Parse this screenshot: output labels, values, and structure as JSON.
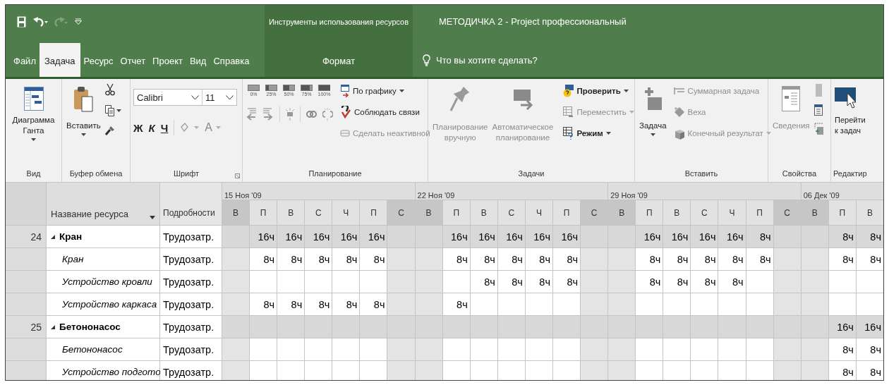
{
  "window": {
    "context_title": "Инструменты использования ресурсов",
    "title": "МЕТОДИЧКА 2  -  Project профессиональный"
  },
  "tabs": [
    {
      "label": "Файл",
      "selected": false,
      "kind": "main"
    },
    {
      "label": "Задача",
      "selected": true,
      "kind": "main"
    },
    {
      "label": "Ресурс",
      "selected": false,
      "kind": "main"
    },
    {
      "label": "Отчет",
      "selected": false,
      "kind": "main"
    },
    {
      "label": "Проект",
      "selected": false,
      "kind": "main"
    },
    {
      "label": "Вид",
      "selected": false,
      "kind": "main"
    },
    {
      "label": "Справка",
      "selected": false,
      "kind": "main"
    },
    {
      "label": "Формат",
      "selected": false,
      "kind": "contextual"
    }
  ],
  "tell_me": {
    "placeholder": "Что вы хотите сделать?"
  },
  "ribbon": {
    "groups": [
      {
        "kind": "view",
        "label": "Вид",
        "button": {
          "lines": [
            "Диаграмма",
            "Ганта"
          ],
          "dropdown": true
        }
      },
      {
        "kind": "clipboard",
        "label": "Буфер обмена",
        "paste": {
          "label": "Вставить",
          "dropdown": true
        }
      },
      {
        "kind": "font",
        "label": "Шрифт",
        "font_name": "Calibri",
        "font_size": "11",
        "bold": "Ж",
        "italic": "К",
        "underline": "Ч",
        "font_color": "A"
      },
      {
        "kind": "schedule",
        "label": "Планирование",
        "percent": [
          "0%",
          "25%",
          "50%",
          "75%",
          "100%"
        ],
        "commands": [
          {
            "label": "По графику",
            "dropdown": true,
            "disabled": false
          },
          {
            "label": "Соблюдать связи",
            "dropdown": false,
            "disabled": false
          },
          {
            "label": "Сделать неактивной",
            "dropdown": false,
            "disabled": true
          }
        ]
      },
      {
        "kind": "tasks",
        "label": "Задачи",
        "large": [
          {
            "lines": [
              "Планирование",
              "вручную"
            ],
            "disabled": true
          },
          {
            "lines": [
              "Автоматическое",
              "планирование"
            ],
            "disabled": true
          }
        ],
        "commands": [
          {
            "label": "Проверить",
            "dropdown": true,
            "disabled": false
          },
          {
            "label": "Переместить",
            "dropdown": true,
            "disabled": true
          },
          {
            "label": "Режим",
            "dropdown": true,
            "disabled": false
          }
        ]
      },
      {
        "kind": "insert",
        "label": "Вставить",
        "large": {
          "label": "Задача",
          "dropdown": true
        },
        "commands": [
          {
            "label": "Суммарная задача",
            "dropdown": false,
            "disabled": true
          },
          {
            "label": "Веха",
            "dropdown": false,
            "disabled": true
          },
          {
            "label": "Конечный результат",
            "dropdown": true,
            "disabled": true
          }
        ]
      },
      {
        "kind": "properties",
        "label": "Свойства",
        "large": {
          "label": "Сведения",
          "disabled": true
        }
      },
      {
        "kind": "editing",
        "label": "Редактир",
        "large": {
          "lines": [
            "Перейти",
            "к задач"
          ]
        }
      }
    ]
  },
  "table": {
    "name_header": "Название ресурса",
    "details_header": "Подробности",
    "weeks": [
      {
        "label": "15 Ноя '09",
        "days": [
          {
            "label": "В",
            "weekend": true
          },
          {
            "label": "П",
            "weekend": false
          },
          {
            "label": "В",
            "weekend": false
          },
          {
            "label": "С",
            "weekend": false
          },
          {
            "label": "Ч",
            "weekend": false
          },
          {
            "label": "П",
            "weekend": false
          },
          {
            "label": "С",
            "weekend": true
          }
        ]
      },
      {
        "label": "22 Ноя '09",
        "days": [
          {
            "label": "В",
            "weekend": true
          },
          {
            "label": "П",
            "weekend": false
          },
          {
            "label": "В",
            "weekend": false
          },
          {
            "label": "С",
            "weekend": false
          },
          {
            "label": "Ч",
            "weekend": false
          },
          {
            "label": "П",
            "weekend": false
          },
          {
            "label": "С",
            "weekend": true
          }
        ]
      },
      {
        "label": "29 Ноя '09",
        "days": [
          {
            "label": "В",
            "weekend": true
          },
          {
            "label": "П",
            "weekend": false
          },
          {
            "label": "В",
            "weekend": false
          },
          {
            "label": "С",
            "weekend": false
          },
          {
            "label": "Ч",
            "weekend": false
          },
          {
            "label": "П",
            "weekend": false
          },
          {
            "label": "С",
            "weekend": true
          }
        ]
      },
      {
        "label": "06 Дек '09",
        "days": [
          {
            "label": "В",
            "weekend": true
          },
          {
            "label": "П",
            "weekend": false
          },
          {
            "label": "В",
            "weekend": false
          }
        ]
      }
    ],
    "rows": [
      {
        "id": "24",
        "name": "Кран",
        "expanded": true,
        "details": "Трудозатр.",
        "cells": [
          null,
          "16ч",
          "16ч",
          "16ч",
          "16ч",
          "16ч",
          null,
          null,
          "16ч",
          "16ч",
          "16ч",
          "16ч",
          "16ч",
          null,
          null,
          "16ч",
          "16ч",
          "16ч",
          "16ч",
          "8ч",
          null,
          null,
          "8ч",
          "8ч"
        ],
        "children": [
          {
            "name": "Кран",
            "details": "Трудозатр.",
            "cells": [
              null,
              "8ч",
              "8ч",
              "8ч",
              "8ч",
              "8ч",
              null,
              null,
              "8ч",
              "8ч",
              "8ч",
              "8ч",
              "8ч",
              null,
              null,
              "8ч",
              "8ч",
              "8ч",
              "8ч",
              "8ч",
              null,
              null,
              "8ч",
              "8ч"
            ]
          },
          {
            "name": "Устройство кровли",
            "details": "Трудозатр.",
            "cells": [
              null,
              null,
              null,
              null,
              null,
              null,
              null,
              null,
              null,
              "8ч",
              "8ч",
              "8ч",
              "8ч",
              null,
              null,
              "8ч",
              "8ч",
              "8ч",
              "8ч",
              null,
              null,
              null,
              null,
              null
            ]
          },
          {
            "name": "Устройство каркаса",
            "details": "Трудозатр.",
            "cells": [
              null,
              "8ч",
              "8ч",
              "8ч",
              "8ч",
              "8ч",
              null,
              null,
              "8ч",
              null,
              null,
              null,
              null,
              null,
              null,
              null,
              null,
              null,
              null,
              null,
              null,
              null,
              null,
              null
            ]
          }
        ]
      },
      {
        "id": "25",
        "name": "Бетононасос",
        "expanded": true,
        "details": "Трудозатр.",
        "cells": [
          null,
          null,
          null,
          null,
          null,
          null,
          null,
          null,
          null,
          null,
          null,
          null,
          null,
          null,
          null,
          null,
          null,
          null,
          null,
          null,
          null,
          null,
          "16ч",
          "16ч"
        ],
        "children": [
          {
            "name": "Бетононасос",
            "details": "Трудозатр.",
            "cells": [
              null,
              null,
              null,
              null,
              null,
              null,
              null,
              null,
              null,
              null,
              null,
              null,
              null,
              null,
              null,
              null,
              null,
              null,
              null,
              null,
              null,
              null,
              "8ч",
              "8ч"
            ]
          },
          {
            "name": "Устройство подгото",
            "details": "Трудозатр.",
            "cells": [
              null,
              null,
              null,
              null,
              null,
              null,
              null,
              null,
              null,
              null,
              null,
              null,
              null,
              null,
              null,
              null,
              null,
              null,
              null,
              null,
              null,
              null,
              "8ч",
              "8ч"
            ]
          }
        ]
      }
    ]
  }
}
